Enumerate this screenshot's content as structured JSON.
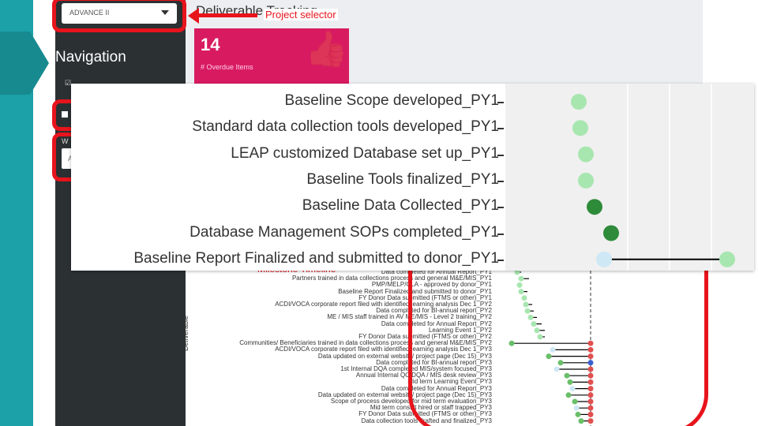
{
  "sidebar": {
    "project_select_value": "ADVANCE II",
    "nav_title": "Navigation",
    "nav_check_label": "☑",
    "nav_w_label": "W",
    "nav_input_value": "A"
  },
  "main": {
    "title": "Deliverable Tracking",
    "tile": {
      "value": "14",
      "label": "# Overdue Items"
    }
  },
  "callout": {
    "project_selector": "Project selector"
  },
  "zoom": {
    "labels": [
      "Baseline Scope developed_PY1",
      "Standard data collection tools developed_PY1",
      "LEAP customized Database set up_PY1",
      "Baseline Tools finalized_PY1",
      "Baseline Data Collected_PY1",
      "Database Management SOPs completed_PY1",
      "Baseline Report Finalized and submitted to donor_PY1"
    ]
  },
  "background_chart": {
    "milestone_title": "Milestone Timeline",
    "y_axis_title": "Deliverable",
    "labels": [
      "Data completed for Annual Report_PY1",
      "Partners trained in data collections process and general M&E/MIS_PY1",
      "PMP/MELP/CLA - approved by donor_PY1",
      "Baseline Report Finalized and submitted to donor_PY1",
      "FY Donor Data submitted (FTMS or other)_PY1",
      "ACDI/VOCA corporate report filed with identified learning analysis Dec 1_PY2",
      "Data completed for BI-annual report_PY2",
      "ME / MIS staff trained in AV ME/MIS - Level 2 training_PY2",
      "Data completed for Annual Report_PY2",
      "Learning Event 1_PY2",
      "FY Donor Data submitted (FTMS or other)_PY2",
      "Communities/ Beneficiaries trained in data collections process and general M&E/MIS_PY2",
      "ACDI/VOCA corporate report filed with identified learning analysis Dec 1_PY3",
      "Data updated on external website/ project page (Dec 15)_PY3",
      "Data completed for BI-annual report_PY3",
      "1st Internal DQA completed MIS/system focused_PY3",
      "Annual Internal QC DQA / MIS desk review_PY3",
      "Mid term Learning Event_PY3",
      "Data completed for Annual Report_PY3",
      "Data updated on external website/ project page (Dec 15)_PY3",
      "Scope of process developed for mid term evaluation_PY3",
      "Mid term consult hired or staff trapped_PY3",
      "FY Donor Data submitted (FTMS or other)_PY3",
      "Data collection tools drafted and finalized_PY3"
    ]
  },
  "colors": {
    "teal": "#1ba1a7",
    "sidebar": "#2b3033",
    "highlight_red": "#e8141c",
    "tile_pink": "#d81b60",
    "light_green": "#a8e6b0",
    "mid_green": "#6abf69",
    "dark_green": "#2e8b3a",
    "light_blue": "#cfe8f5",
    "overdue_red": "#e05050",
    "blue_dot": "#3a5fd0"
  }
}
